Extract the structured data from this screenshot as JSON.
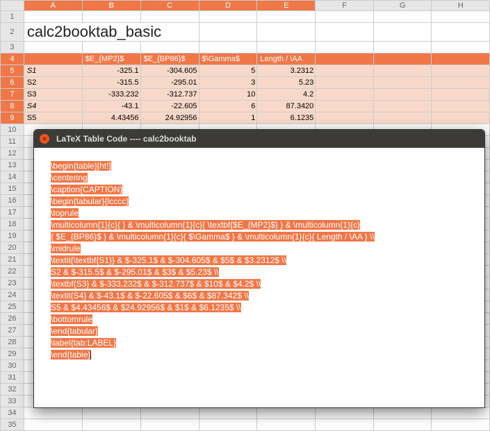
{
  "columns": [
    "A",
    "B",
    "C",
    "D",
    "E",
    "F",
    "G",
    "H"
  ],
  "row_numbers": [
    "1",
    "2",
    "3",
    "4",
    "5",
    "6",
    "7",
    "8",
    "9",
    "10",
    "11",
    "12",
    "13",
    "14",
    "15",
    "16",
    "17",
    "18",
    "19",
    "20",
    "21",
    "22",
    "23",
    "24",
    "25",
    "26",
    "27",
    "28",
    "29",
    "30",
    "31",
    "32",
    "33",
    "34",
    "35"
  ],
  "title_cell": "calc2booktab_basic",
  "headers": {
    "B": "$E_{MP2}$",
    "C": "$E_{BP86}$",
    "D": "$\\Gamma$",
    "E": "Length / \\AA"
  },
  "rows": [
    {
      "label": "S1",
      "B": "-325.1",
      "C": "-304.605",
      "D": "5",
      "E": "3.2312",
      "bold": true,
      "italic": true
    },
    {
      "label": "S2",
      "B": "-315.5",
      "C": "-295.01",
      "D": "3",
      "E": "5.23"
    },
    {
      "label": "S3",
      "B": "-333.232",
      "C": "-312.737",
      "D": "10",
      "E": "4.2",
      "bold": true
    },
    {
      "label": "S4",
      "B": "-43.1",
      "C": "-22.605",
      "D": "6",
      "E": "87.3420",
      "italic": true
    },
    {
      "label": "S5",
      "B": "4.43456",
      "C": "24.92956",
      "D": "1",
      "E": "6.1235"
    }
  ],
  "dialog": {
    "title": "LaTeX Table Code ---- calc2booktab",
    "code": [
      "\\begin{table}[ht!]",
      "\\centering",
      "\\caption{CAPTION}",
      "\\begin{tabular}{lcccc}",
      "\\toprule",
      "\\multicolumn{1}{c}{  } & \\multicolumn{1}{c}{ \\textbf{$E_{MP2}$} } & \\multicolumn{1}{c}{ $E_{BP86}$ } & \\multicolumn{1}{c}{ $\\Gamma$ } & \\multicolumn{1}{c}{ Length / \\AA } \\\\",
      "\\midrule",
      "\\textit{\\textbf{S1}} & $-325.1$ & $-304.605$ & $5$ & $3.2312$ \\\\",
      "S2 & $-315.5$ & $-295.01$ & $3$ & $5.23$ \\\\",
      "\\textbf{S3} & $-333.232$ & $-312.737$ & $10$ & $4.2$ \\\\",
      "\\textit{S4} & $-43.1$ & $-22.605$ & $6$ & $87.342$ \\\\",
      "S5 & $4.43456$ & $24.92956$ & $1$ & $6.1235$ \\\\",
      "\\bottomrule",
      "\\end{tabular}",
      "\\label{tab:LABEL}",
      "\\end{table}"
    ]
  }
}
